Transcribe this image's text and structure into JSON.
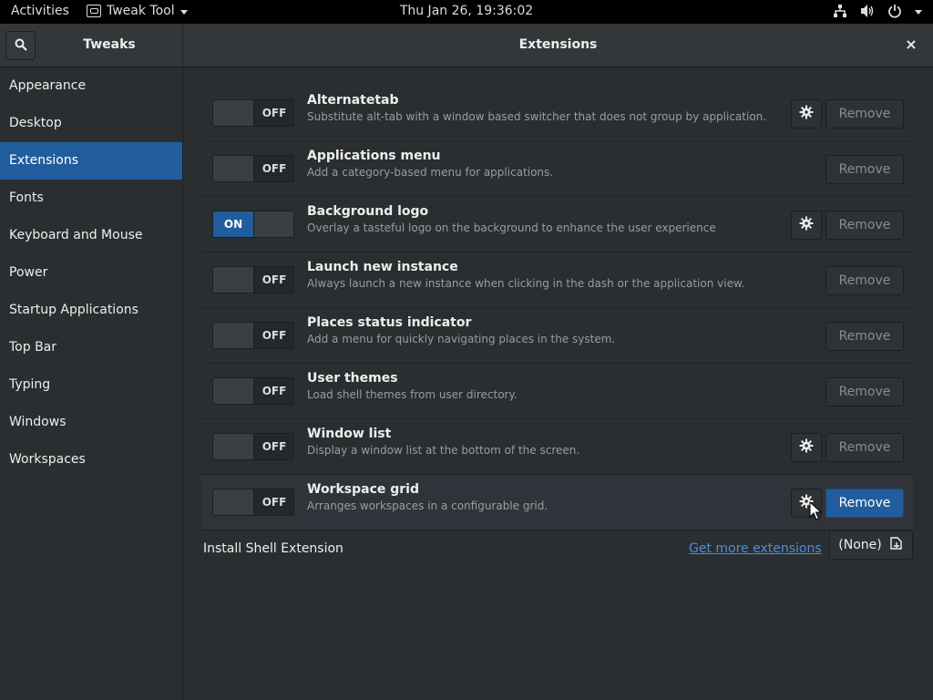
{
  "topbar": {
    "activities": "Activities",
    "app_menu": "Tweak Tool",
    "clock": "Thu Jan 26, 19:36:02"
  },
  "header": {
    "left_title": "Tweaks",
    "main_title": "Extensions",
    "close": "×"
  },
  "sidebar": {
    "items": [
      {
        "label": "Appearance"
      },
      {
        "label": "Desktop"
      },
      {
        "label": "Extensions",
        "active": true
      },
      {
        "label": "Fonts"
      },
      {
        "label": "Keyboard and Mouse"
      },
      {
        "label": "Power"
      },
      {
        "label": "Startup Applications"
      },
      {
        "label": "Top Bar"
      },
      {
        "label": "Typing"
      },
      {
        "label": "Windows"
      },
      {
        "label": "Workspaces"
      }
    ]
  },
  "extensions": [
    {
      "name": "Alternatetab",
      "desc": "Substitute alt-tab with a window based switcher that does not group by application.",
      "state": "OFF",
      "has_settings": true,
      "remove": "Remove"
    },
    {
      "name": "Applications menu",
      "desc": "Add a category-based menu for applications.",
      "state": "OFF",
      "has_settings": false,
      "remove": "Remove"
    },
    {
      "name": "Background logo",
      "desc": "Overlay a tasteful logo on the background to enhance the user experience",
      "state": "ON",
      "has_settings": true,
      "remove": "Remove"
    },
    {
      "name": "Launch new instance",
      "desc": "Always launch a new instance when clicking in the dash or the application view.",
      "state": "OFF",
      "has_settings": false,
      "remove": "Remove"
    },
    {
      "name": "Places status indicator",
      "desc": "Add a menu for quickly navigating places in the system.",
      "state": "OFF",
      "has_settings": false,
      "remove": "Remove"
    },
    {
      "name": "User themes",
      "desc": "Load shell themes from user directory.",
      "state": "OFF",
      "has_settings": false,
      "remove": "Remove"
    },
    {
      "name": "Window list",
      "desc": "Display a window list at the bottom of the screen.",
      "state": "OFF",
      "has_settings": true,
      "remove": "Remove"
    },
    {
      "name": "Workspace grid",
      "desc": "Arranges workspaces in a configurable grid.",
      "state": "OFF",
      "has_settings": true,
      "remove": "Remove",
      "hover": true
    }
  ],
  "install": {
    "label": "Install Shell Extension",
    "more_link": "Get more extensions",
    "file_button": "(None)"
  },
  "colors": {
    "accent": "#215d9c",
    "link": "#4a90d9",
    "background": "#2b2e30"
  },
  "icons": {
    "search": "search-icon",
    "gear": "gear-icon",
    "network": "network-icon",
    "volume": "volume-icon",
    "power": "power-icon",
    "file": "document-open-icon",
    "close": "close-icon"
  }
}
